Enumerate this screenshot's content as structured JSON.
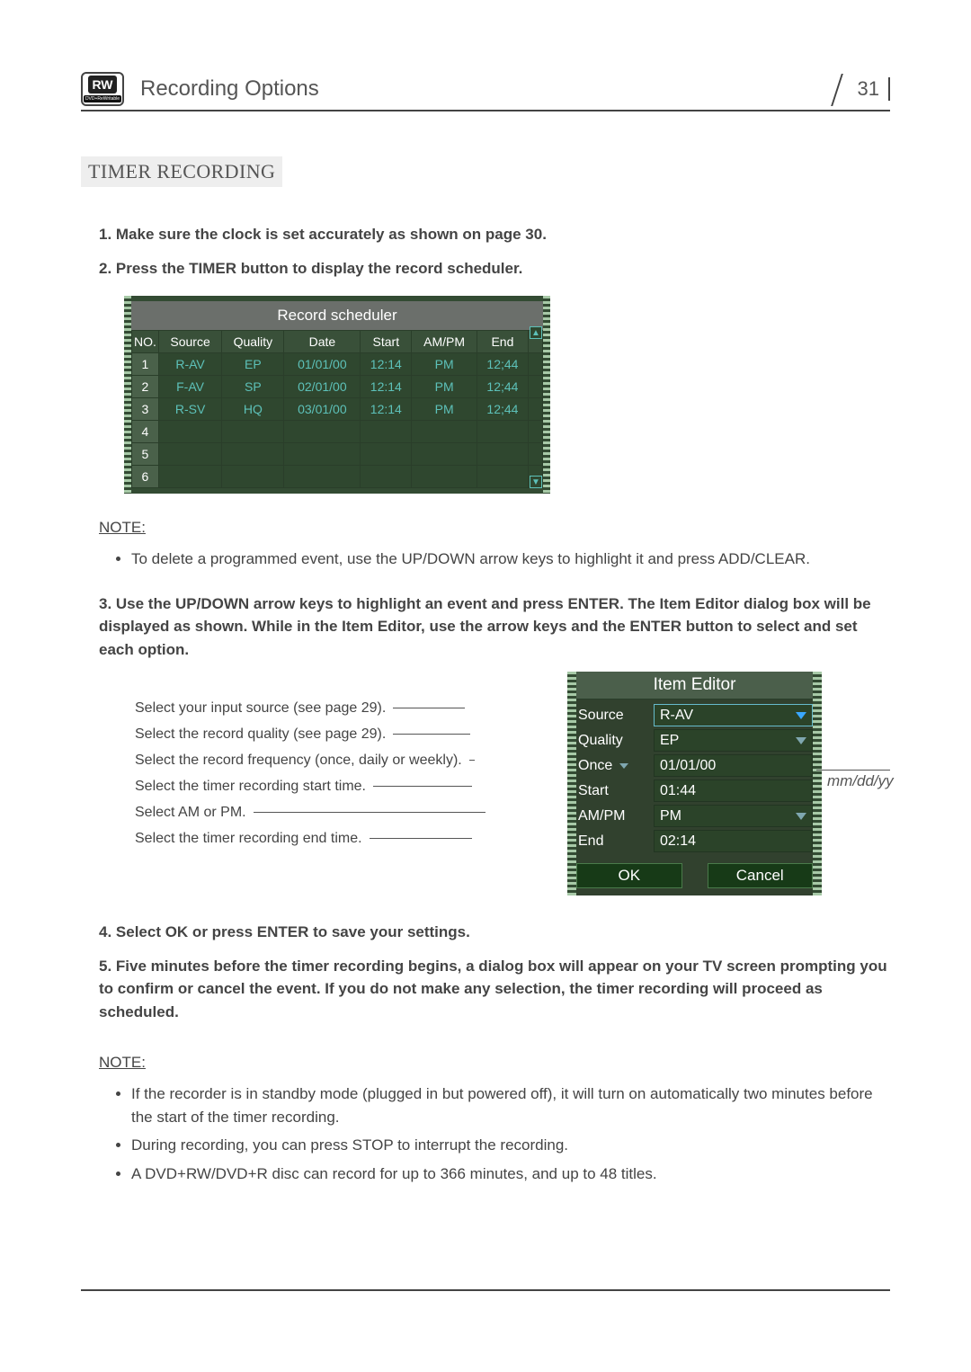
{
  "header": {
    "badge_main": "RW",
    "badge_sub": "DVD+ReWritable",
    "title": "Recording Options",
    "page_number": "31"
  },
  "section_label": "TIMER RECORDING",
  "steps": {
    "s1": "1. Make sure the clock is set accurately as shown on page 30.",
    "s2": "2. Press the TIMER button to display the record scheduler.",
    "s3": "3. Use the UP/DOWN arrow keys to highlight an event and press ENTER. The Item Editor dialog box will be displayed as shown. While in the Item Editor, use the arrow keys and the ENTER button to select and set each option.",
    "s4": "4. Select OK or press ENTER to save your settings.",
    "s5": "5. Five minutes before the timer recording begins, a dialog box will appear on your TV screen prompting you to confirm or cancel the event. If you do not make any selection, the timer recording will proceed as scheduled."
  },
  "note_label": "NOTE:",
  "note1_bullets": [
    "To delete a programmed event, use the UP/DOWN arrow keys to highlight it and press ADD/CLEAR."
  ],
  "note2_bullets": [
    "If the recorder is in standby mode (plugged in but powered off), it will turn on automatically two minutes before the start of the timer recording.",
    "During recording, you can press STOP to interrupt the recording.",
    "A DVD+RW/DVD+R disc can record for up to 366 minutes, and up to 48 titles."
  ],
  "scheduler": {
    "title": "Record scheduler",
    "headers": [
      "NO.",
      "Source",
      "Quality",
      "Date",
      "Start",
      "AM/PM",
      "End"
    ],
    "rows": [
      {
        "no": "1",
        "source": "R-AV",
        "quality": "EP",
        "date": "01/01/00",
        "start": "12:14",
        "ampm": "PM",
        "end": "12;44"
      },
      {
        "no": "2",
        "source": "F-AV",
        "quality": "SP",
        "date": "02/01/00",
        "start": "12:14",
        "ampm": "PM",
        "end": "12;44"
      },
      {
        "no": "3",
        "source": "R-SV",
        "quality": "HQ",
        "date": "03/01/00",
        "start": "12:14",
        "ampm": "PM",
        "end": "12;44"
      },
      {
        "no": "4",
        "source": "",
        "quality": "",
        "date": "",
        "start": "",
        "ampm": "",
        "end": ""
      },
      {
        "no": "5",
        "source": "",
        "quality": "",
        "date": "",
        "start": "",
        "ampm": "",
        "end": ""
      },
      {
        "no": "6",
        "source": "",
        "quality": "",
        "date": "",
        "start": "",
        "ampm": "",
        "end": ""
      }
    ]
  },
  "editor_labels": {
    "l0": "Select your input source (see page 29).",
    "l1": "Select the record quality (see page 29).",
    "l2": "Select the record frequency (once, daily or weekly).",
    "l3": "Select the timer recording start time.",
    "l4": "Select AM or PM.",
    "l5": "Select the timer recording end time."
  },
  "item_editor": {
    "title": "Item Editor",
    "rows": {
      "source": {
        "label": "Source",
        "value": "R-AV"
      },
      "quality": {
        "label": "Quality",
        "value": "EP"
      },
      "freq": {
        "label": "Once",
        "value": "01/01/00"
      },
      "start": {
        "label": "Start",
        "value": "01:44"
      },
      "ampm": {
        "label": "AM/PM",
        "value": "PM"
      },
      "end": {
        "label": "End",
        "value": "02:14"
      }
    },
    "ok": "OK",
    "cancel": "Cancel"
  },
  "side_note": "mm/dd/yy"
}
